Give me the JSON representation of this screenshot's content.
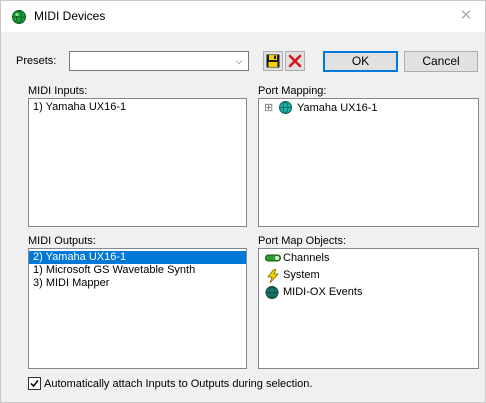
{
  "window": {
    "title": "MIDI Devices",
    "close_glyph": "✕",
    "title_icon": "midi-ox-green-globe-icon"
  },
  "presets": {
    "label": "Presets:",
    "value": "",
    "dropdown_glyph": "⌵"
  },
  "toolbar": {
    "save_icon": "floppy-save-icon",
    "delete_icon": "red-x-delete-icon",
    "ok_label": "OK",
    "cancel_label": "Cancel"
  },
  "midi_inputs": {
    "label": "MIDI Inputs:",
    "items": [
      "1) Yamaha UX16-1"
    ]
  },
  "port_mapping": {
    "label": "Port Mapping:",
    "items": [
      {
        "expander": "⊞",
        "icon": "midi-port-globe-icon",
        "text": "Yamaha UX16-1"
      }
    ]
  },
  "midi_outputs": {
    "label": "MIDI Outputs:",
    "items": [
      {
        "text": "2) Yamaha UX16-1",
        "selected": true
      },
      {
        "text": "1) Microsoft GS Wavetable Synth",
        "selected": false
      },
      {
        "text": "3) MIDI Mapper",
        "selected": false
      }
    ]
  },
  "port_map_objects": {
    "label": "Port Map Objects:",
    "items": [
      {
        "icon": "channels-icon",
        "text": "Channels"
      },
      {
        "icon": "system-lightning-icon",
        "text": "System"
      },
      {
        "icon": "midi-ox-events-icon",
        "text": "MIDI-OX Events"
      }
    ]
  },
  "auto_attach": {
    "checked": true,
    "label": "Automatically attach Inputs to Outputs during selection."
  },
  "colors": {
    "selection": "#0078d7",
    "default_button_border": "#0078d7",
    "green_icon": "#1c9c3c"
  }
}
